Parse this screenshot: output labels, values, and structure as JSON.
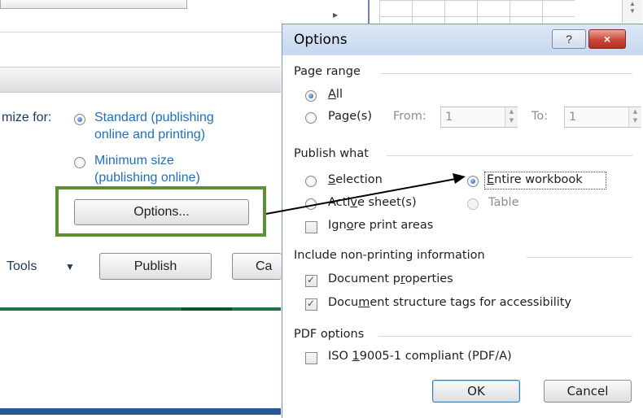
{
  "background_dialog": {
    "optimize_label": "mize for:",
    "standard_option": "Standard (publishing\nonline and printing)",
    "standard_line1": "Standard (publishing",
    "standard_line2": "online and printing)",
    "minimum_line1": "Minimum size",
    "minimum_line2": "(publishing online)",
    "options_button": "Options...",
    "tools_label": "Tools",
    "publish_button": "Publish",
    "cancel_button_partial": "Ca",
    "selected_optimize": "standard"
  },
  "options_dialog": {
    "title": "Options",
    "help_button": "?",
    "close_button": "×",
    "page_range": {
      "heading": "Page range",
      "all_label": "All",
      "all_access": "A",
      "all_rest": "ll",
      "pages_pre": "Pa",
      "pages_access": "g",
      "pages_post": "e(s)",
      "from_label": "From:",
      "from_value": "1",
      "to_label": "To:",
      "to_value": "1",
      "selected": "all"
    },
    "publish_what": {
      "heading": "Publish what",
      "selection_access": "S",
      "selection_rest": "election",
      "entire_access": "E",
      "entire_rest": "ntire workbook",
      "active_pre": "Acti",
      "active_access": "v",
      "active_post": "e sheet(s)",
      "table_label": "Table",
      "ignore_pre": "Ign",
      "ignore_access": "o",
      "ignore_post": "re print areas",
      "selected": "entire_workbook",
      "ignore_checked": false
    },
    "non_printing": {
      "heading": "Include non-printing information",
      "doc_props_pre": "Document p",
      "doc_props_access": "r",
      "doc_props_post": "operties",
      "doc_props_checked": true,
      "structure_pre": "Docu",
      "structure_access": "m",
      "structure_post": "ent structure tags for accessibility",
      "structure_checked": true
    },
    "pdf_options": {
      "heading": "PDF options",
      "iso_pre": "ISO ",
      "iso_access": "1",
      "iso_post": "9005-1 compliant (PDF/A)",
      "iso_checked": false
    },
    "ok_button": "OK",
    "cancel_button": "Cancel"
  },
  "colors": {
    "highlight_box": "#5e8f35",
    "accent_blue": "#2b579a",
    "excel_green": "#217346",
    "close_red": "#c9483a"
  }
}
